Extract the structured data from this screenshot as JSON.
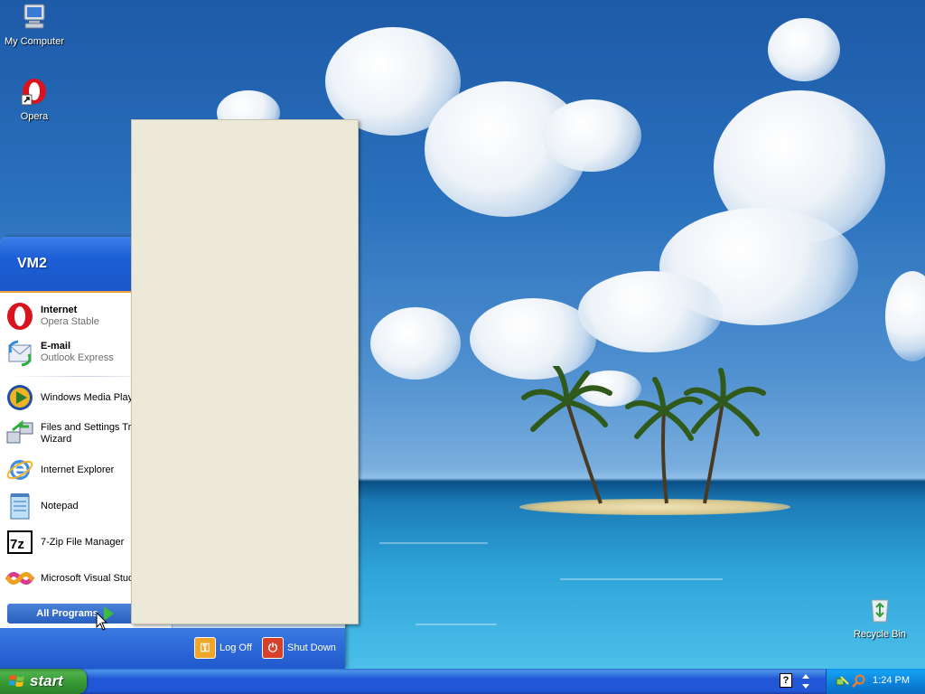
{
  "desktop": {
    "icons": [
      {
        "label": "My Computer",
        "icon": "computer-icon"
      },
      {
        "label": "Opera",
        "icon": "opera-icon"
      },
      {
        "label": "Recycle Bin",
        "icon": "recycle-bin-icon"
      }
    ]
  },
  "start_menu": {
    "username": "VM2",
    "pinned": [
      {
        "title": "Internet",
        "subtitle": "Opera Stable",
        "icon": "opera-icon"
      },
      {
        "title": "E-mail",
        "subtitle": "Outlook Express",
        "icon": "outlook-express-icon"
      }
    ],
    "recent": [
      {
        "label": "Windows Media Player",
        "icon": "windows-media-player-icon"
      },
      {
        "label": "Files and Settings Transfer Wizard",
        "icon": "transfer-wizard-icon"
      },
      {
        "label": "Internet Explorer",
        "icon": "internet-explorer-icon"
      },
      {
        "label": "Notepad",
        "icon": "notepad-icon"
      },
      {
        "label": "7-Zip File Manager",
        "icon": "7zip-icon"
      },
      {
        "label": "Microsoft Visual Studio",
        "icon": "visual-studio-icon"
      }
    ],
    "all_programs_label": "All Programs",
    "log_off_label": "Log Off",
    "shut_down_label": "Shut Down"
  },
  "taskbar": {
    "start_label": "start",
    "clock": "1:24 PM"
  },
  "colors": {
    "taskbar_blue": "#2157d7",
    "start_green": "#379a35",
    "flyout_bg": "#ece9d8"
  }
}
